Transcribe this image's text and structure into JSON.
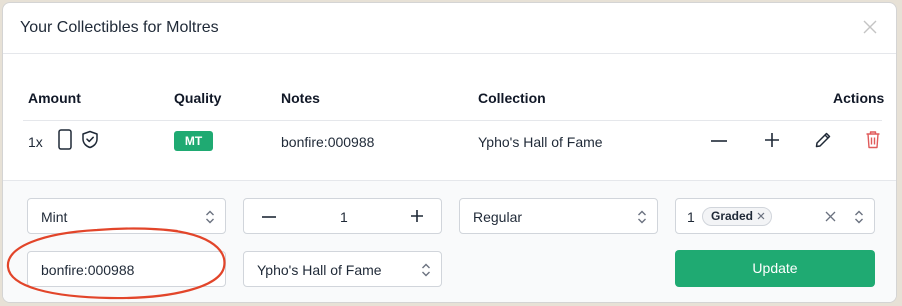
{
  "modal": {
    "title": "Your Collectibles for Moltres"
  },
  "table": {
    "headers": {
      "amount": "Amount",
      "quality": "Quality",
      "notes": "Notes",
      "collection": "Collection",
      "actions": "Actions"
    },
    "row": {
      "amount": "1x",
      "quality_badge": "MT",
      "notes": "bonfire:000988",
      "collection": "Ypho's Hall of Fame"
    }
  },
  "form": {
    "quality_select": "Mint",
    "quantity_value": "1",
    "variant_select": "Regular",
    "grading": {
      "count": "1",
      "chip_label": "Graded"
    },
    "notes_input": "bonfire:000988",
    "collection_select": "Ypho's Hall of Fame",
    "update_label": "Update"
  },
  "colors": {
    "accent": "#1faa72",
    "danger": "#e05a5a",
    "annotation": "#e2452a"
  },
  "icons": [
    "close-icon",
    "card-icon",
    "shield-check-icon",
    "minus-icon",
    "plus-icon",
    "pencil-icon",
    "trash-icon",
    "chevron-updown-icon",
    "x-icon"
  ]
}
